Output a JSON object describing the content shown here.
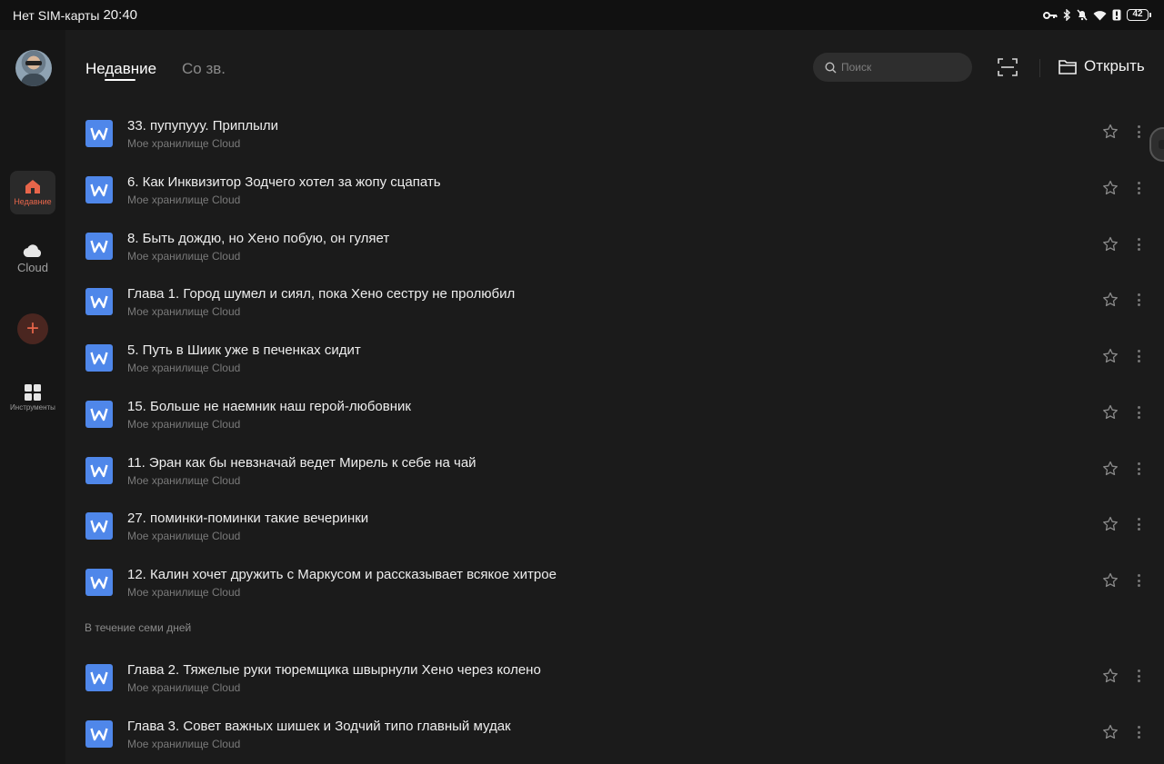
{
  "status_bar": {
    "carrier": "Нет SIM-карты",
    "time": "20:40",
    "battery": "42"
  },
  "sidebar": {
    "items": [
      {
        "label": "Недавние",
        "icon": "home-icon",
        "active": true
      },
      {
        "label": "Cloud",
        "icon": "cloud-icon",
        "active": false
      },
      {
        "label": "Инструменты",
        "icon": "tools-grid-icon",
        "active": false
      }
    ],
    "add_icon": "plus-icon"
  },
  "header": {
    "tabs": [
      {
        "label": "Недавние",
        "active": true
      },
      {
        "label": "Со зв.",
        "active": false
      }
    ],
    "search_placeholder": "Поиск",
    "open_label": "Открыть"
  },
  "files": {
    "recent": [
      {
        "title": "33. пупупууу. Приплыли",
        "location": "Мое хранилище Cloud"
      },
      {
        "title": "6. Как Инквизитор Зодчего хотел за жопу сцапать",
        "location": "Мое хранилище Cloud"
      },
      {
        "title": "8. Быть дождю, но Хено побую, он гуляет",
        "location": "Мое хранилище Cloud"
      },
      {
        "title": "Глава 1. Город шумел и сиял, пока Хено сестру не пролюбил",
        "location": "Мое хранилище Cloud"
      },
      {
        "title": "5. Путь в Шиик уже в печенках сидит",
        "location": "Мое хранилище Cloud"
      },
      {
        "title": "15. Больше не наемник наш герой-любовник",
        "location": "Мое хранилище Cloud"
      },
      {
        "title": "11. Эран как бы невзначай ведет Мирель к себе на чай",
        "location": "Мое хранилище Cloud"
      },
      {
        "title": "27. поминки-поминки такие вечеринки",
        "location": "Мое хранилище Cloud"
      },
      {
        "title": "12. Калин хочет дружить с Маркусом и рассказывает всякое хитрое",
        "location": "Мое хранилище Cloud"
      }
    ],
    "week_section_label": "В течение семи дней",
    "week": [
      {
        "title": "Глава 2. Тяжелые руки тюремщика швырнули Хено через колено",
        "location": "Мое хранилище Cloud"
      },
      {
        "title": "Глава 3. Совет важных шишек и Зодчий типо главный мудак",
        "location": "Мое хранилище Cloud"
      }
    ]
  },
  "colors": {
    "accent": "#e7654a",
    "doc_icon": "#4f87ea",
    "background": "#1b1b1b",
    "sidebar": "#161616"
  }
}
